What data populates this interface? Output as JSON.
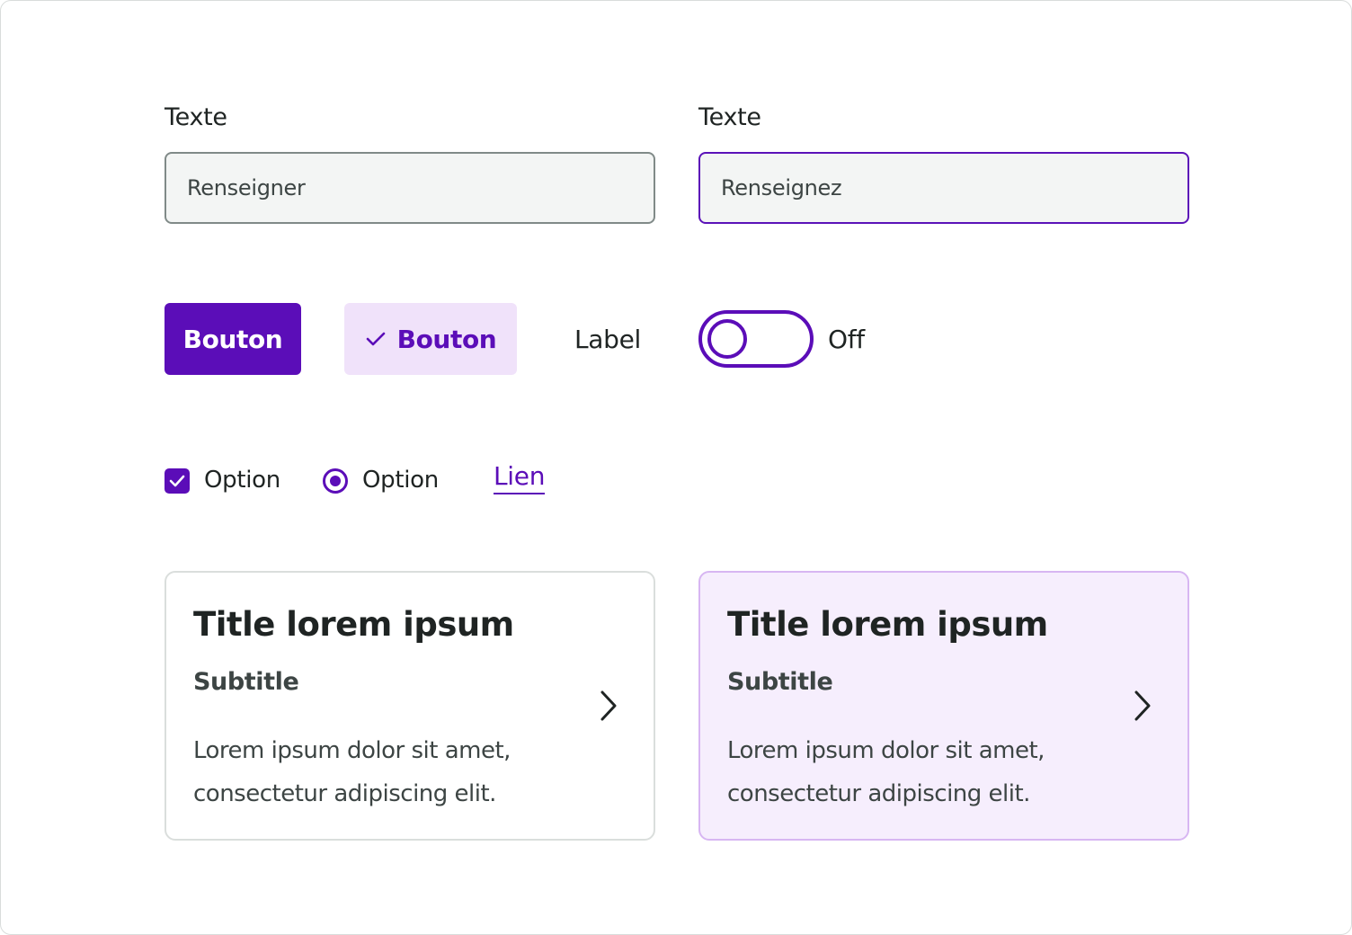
{
  "colors": {
    "primary": "#5b0db8",
    "primary_light": "#f0e2fa",
    "card_selected_bg": "#f6eefd",
    "card_selected_border": "#d7b6f2",
    "input_bg": "#f3f5f4",
    "input_border": "#808a88",
    "text_dark": "#1f2423",
    "text_muted": "#3d4544"
  },
  "fields": [
    {
      "label": "Texte",
      "placeholder": "Renseigner",
      "state": "default"
    },
    {
      "label": "Texte",
      "placeholder": "Renseignez",
      "state": "focus"
    }
  ],
  "buttons": {
    "primary_label": "Bouton",
    "secondary_label": "Bouton",
    "secondary_icon": "check-icon"
  },
  "label_text": "Label",
  "toggle": {
    "state_label": "Off",
    "checked": false
  },
  "checkbox": {
    "label": "Option",
    "checked": true,
    "icon": "check-icon"
  },
  "radio": {
    "label": "Option",
    "selected": true
  },
  "link": {
    "label": "Lien"
  },
  "cards": [
    {
      "title": "Title lorem ipsum",
      "subtitle": "Subtitle",
      "body": "Lorem ipsum dolor sit amet, consectetur adipiscing elit.",
      "icon": "chevron-right-icon",
      "state": "default"
    },
    {
      "title": "Title lorem ipsum",
      "subtitle": "Subtitle",
      "body": "Lorem ipsum dolor sit amet, consectetur adipiscing elit.",
      "icon": "chevron-right-icon",
      "state": "selected"
    }
  ]
}
